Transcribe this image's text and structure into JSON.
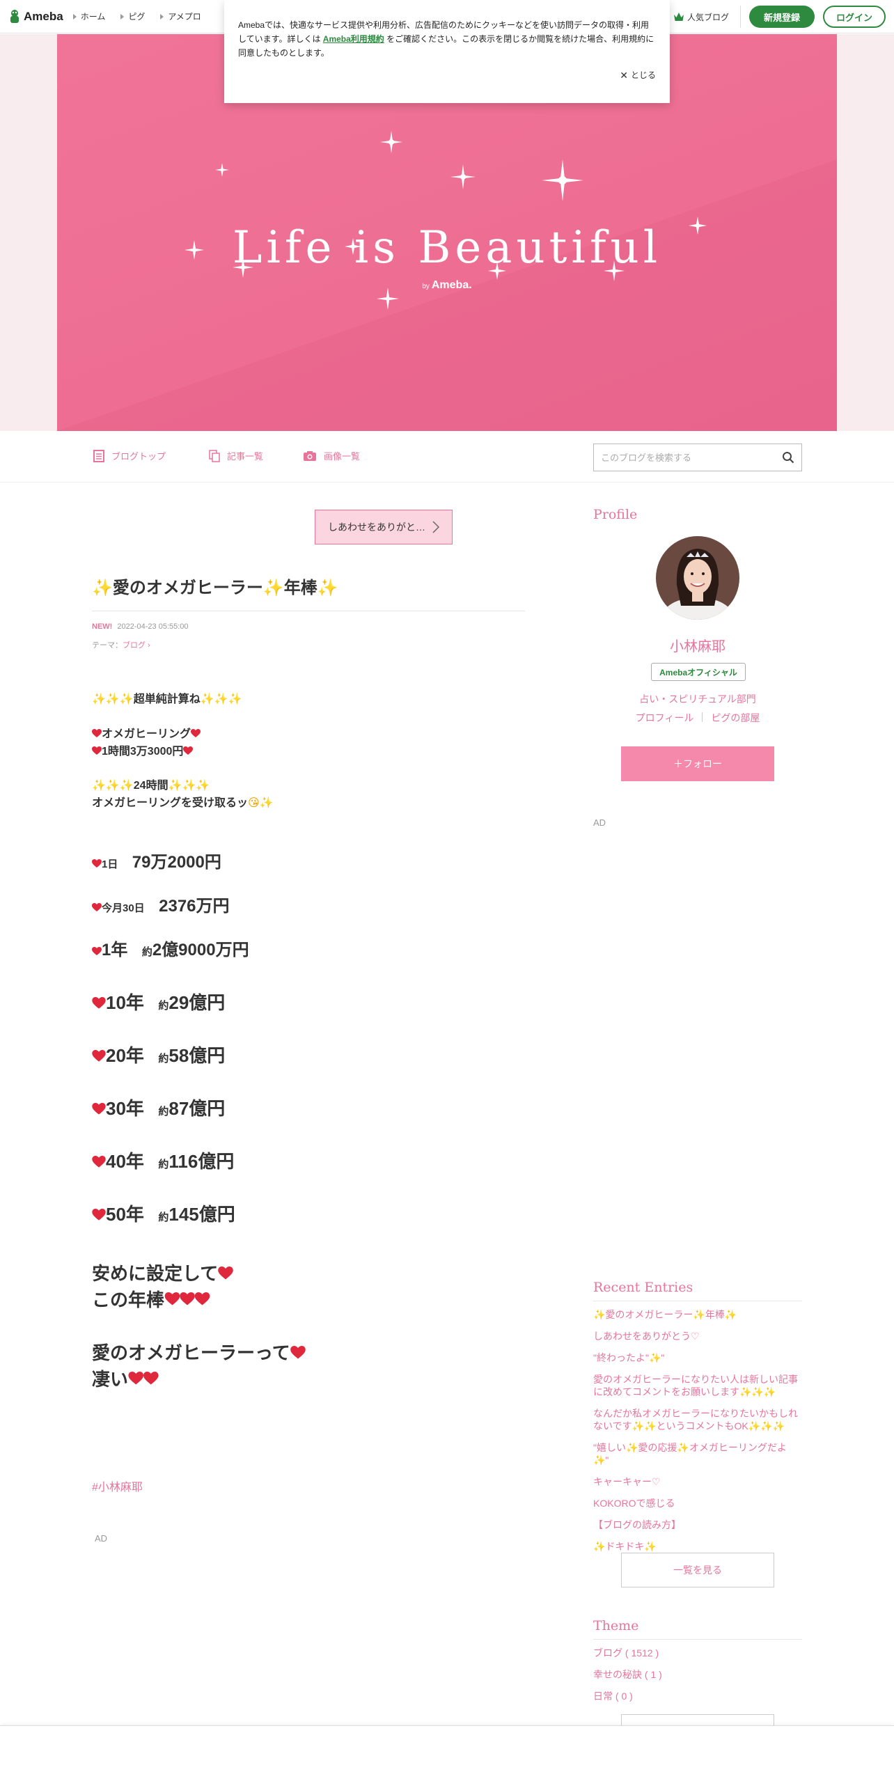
{
  "global_header": {
    "logo_text": "Ameba",
    "nav": [
      "ホーム",
      "ピグ",
      "アメプロ"
    ],
    "popular_blog": "人気ブログ",
    "register": "新規登録",
    "login": "ログイン"
  },
  "cookie_notice": {
    "text_before": "Amebaでは、快適なサービス提供や利用分析、広告配信のためにクッキーなどを使い訪問データの取得・利用しています。詳しくは",
    "link": "Ameba利用規約",
    "text_after": "をご確認ください。この表示を閉じるか閲覧を続けた場合、利用規約に同意したものとします。",
    "close": "とじる"
  },
  "hero": {
    "title": "Life is Beautiful",
    "by": "by",
    "brand": "Ameba."
  },
  "blog_nav": {
    "items": [
      "ブログトップ",
      "記事一覧",
      "画像一覧"
    ],
    "search_placeholder": "このブログを検索する"
  },
  "entry": {
    "prev_button": "しあわせをありがと…",
    "title": "✨愛のオメガヒーラー✨年棒✨",
    "new_badge": "NEW!",
    "date": "2022-04-23 05:55:00",
    "theme_label": "テーマ：",
    "theme": "ブログ",
    "p1": "超単純計算ね",
    "p2a": "オメガヒーリング",
    "p2b": "1時間3万3000円",
    "p3a": "24時間",
    "p3b": "オメガヒーリングを受け取るッ",
    "rows": [
      {
        "label": "1日",
        "value": "79万2000円"
      },
      {
        "label": "今月30日",
        "value": "2376万円"
      },
      {
        "label": "1年",
        "prefix": "約",
        "value": "2億9000万円"
      },
      {
        "label": "10年",
        "prefix": "約",
        "value": "29億円"
      },
      {
        "label": "20年",
        "prefix": "約",
        "value": "58億円"
      },
      {
        "label": "30年",
        "prefix": "約",
        "value": "87億円"
      },
      {
        "label": "40年",
        "prefix": "約",
        "value": "116億円"
      },
      {
        "label": "50年",
        "prefix": "約",
        "value": "145億円"
      }
    ],
    "closing1": "安めに設定して",
    "closing2": "この年棒",
    "closing3": "愛のオメガヒーラーって",
    "closing4": "凄い",
    "hashtag": "#小林麻耶",
    "ad": "AD"
  },
  "sidebar": {
    "profile_heading": "Profile",
    "name": "小林麻耶",
    "official_badge": "Amebaオフィシャル",
    "category": "占い・スピリチュアル部門",
    "link_profile": "プロフィール",
    "link_pig": "ピグの部屋",
    "follow": "＋フォロー",
    "ad": "AD",
    "recent_heading": "Recent Entries",
    "recent": [
      "✨愛のオメガヒーラー✨年棒✨",
      "しあわせをありがとう♡",
      "\"終わったよ\"✨\"",
      "愛のオメガヒーラーになりたい人は新しい記事に改めてコメントをお願いします✨✨✨",
      "なんだか私オメガヒーラーになりたいかもしれないです✨✨というコメントもOK✨✨✨",
      "\"嬉しい✨愛の応援✨オメガヒーリングだよ✨\"",
      "キャーキャー♡",
      "KOKOROで感じる",
      "【ブログの読み方】",
      "✨ドキドキ✨"
    ],
    "see_all": "一覧を見る",
    "theme_heading": "Theme",
    "themes": [
      "ブログ ( 1512 )",
      "幸せの秘訣 ( 1 )",
      "日常 ( 0 )"
    ]
  },
  "colors": {
    "accent_pink": "#e8749a",
    "banner_pink": "#ee6e93",
    "ameba_green": "#2d8a3e",
    "heart_red": "#e0283c"
  }
}
